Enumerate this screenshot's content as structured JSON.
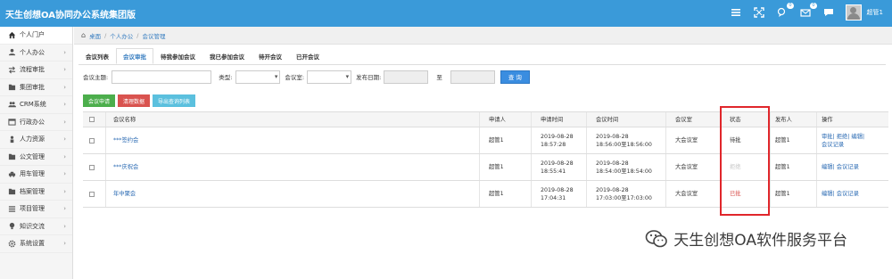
{
  "app": {
    "title": "天生创想OA协同办公系统集团版"
  },
  "header": {
    "badge_1": "0",
    "badge_2": "0",
    "username": "超管1"
  },
  "sidebar": {
    "items": [
      {
        "label": "个人门户",
        "icon": "home-icon"
      },
      {
        "label": "个人办公",
        "icon": "user-icon"
      },
      {
        "label": "流程审批",
        "icon": "exchange-icon"
      },
      {
        "label": "集团审批",
        "icon": "folder-icon"
      },
      {
        "label": "CRM系统",
        "icon": "users-icon"
      },
      {
        "label": "行政办公",
        "icon": "calendar-icon"
      },
      {
        "label": "人力资源",
        "icon": "person-icon"
      },
      {
        "label": "公文管理",
        "icon": "document-icon"
      },
      {
        "label": "用车管理",
        "icon": "car-icon"
      },
      {
        "label": "档案管理",
        "icon": "archive-icon"
      },
      {
        "label": "项目管理",
        "icon": "list-icon"
      },
      {
        "label": "知识交流",
        "icon": "bulb-icon"
      },
      {
        "label": "系统设置",
        "icon": "gear-icon"
      }
    ]
  },
  "breadcrumb": {
    "home": "桌面",
    "level1": "个人办公",
    "level2": "会议管理"
  },
  "tabs": [
    {
      "label": "会议列表"
    },
    {
      "label": "会议审批"
    },
    {
      "label": "待我参加会议"
    },
    {
      "label": "我已参加会议"
    },
    {
      "label": "待开会议"
    },
    {
      "label": "已开会议"
    }
  ],
  "filter": {
    "subject_label": "会议主题:",
    "type_label": "类型:",
    "room_label": "会议室:",
    "date_label": "发布日期:",
    "to_label": "至",
    "query_button": "查 询"
  },
  "actions": {
    "apply": "会议申请",
    "clear": "清理数据",
    "export": "导出查询列表"
  },
  "table": {
    "columns": [
      "会议名称",
      "申请人",
      "申请时间",
      "会议时间",
      "会议室",
      "状态",
      "发布人",
      "操作"
    ],
    "rows": [
      {
        "name": "***签约会",
        "applicant": "超管1",
        "apply_date": "2019-08-28",
        "apply_time": "18:57:28",
        "meet_date": "2019-08-28",
        "meet_time": "18:56:00至18:56:00",
        "room": "大会议室",
        "status": "待批",
        "publisher": "超管1",
        "ops_line1": "审批| 拒绝| 编辑|",
        "ops_line2": "会议记录"
      },
      {
        "name": "***庆祝会",
        "applicant": "超管1",
        "apply_date": "2019-08-28",
        "apply_time": "18:55:41",
        "meet_date": "2019-08-28",
        "meet_time": "18:54:00至18:54:00",
        "room": "大会议室",
        "status": "拒绝",
        "publisher": "超管1",
        "ops_line1": "编辑| 会议记录",
        "ops_line2": ""
      },
      {
        "name": "年中聚会",
        "applicant": "超管1",
        "apply_date": "2019-08-28",
        "apply_time": "17:04:31",
        "meet_date": "2019-08-28",
        "meet_time": "17:03:00至17:03:00",
        "room": "大会议室",
        "status": "已批",
        "publisher": "超管1",
        "ops_line1": "编辑| 会议记录",
        "ops_line2": ""
      }
    ]
  },
  "watermark": {
    "text": "天生创想OA软件服务平台"
  },
  "colors": {
    "header": "#3a9ad9",
    "status_approved": "#d9534f",
    "status_rejected": "#c7c7c7",
    "highlight_box": "#e0262b"
  }
}
